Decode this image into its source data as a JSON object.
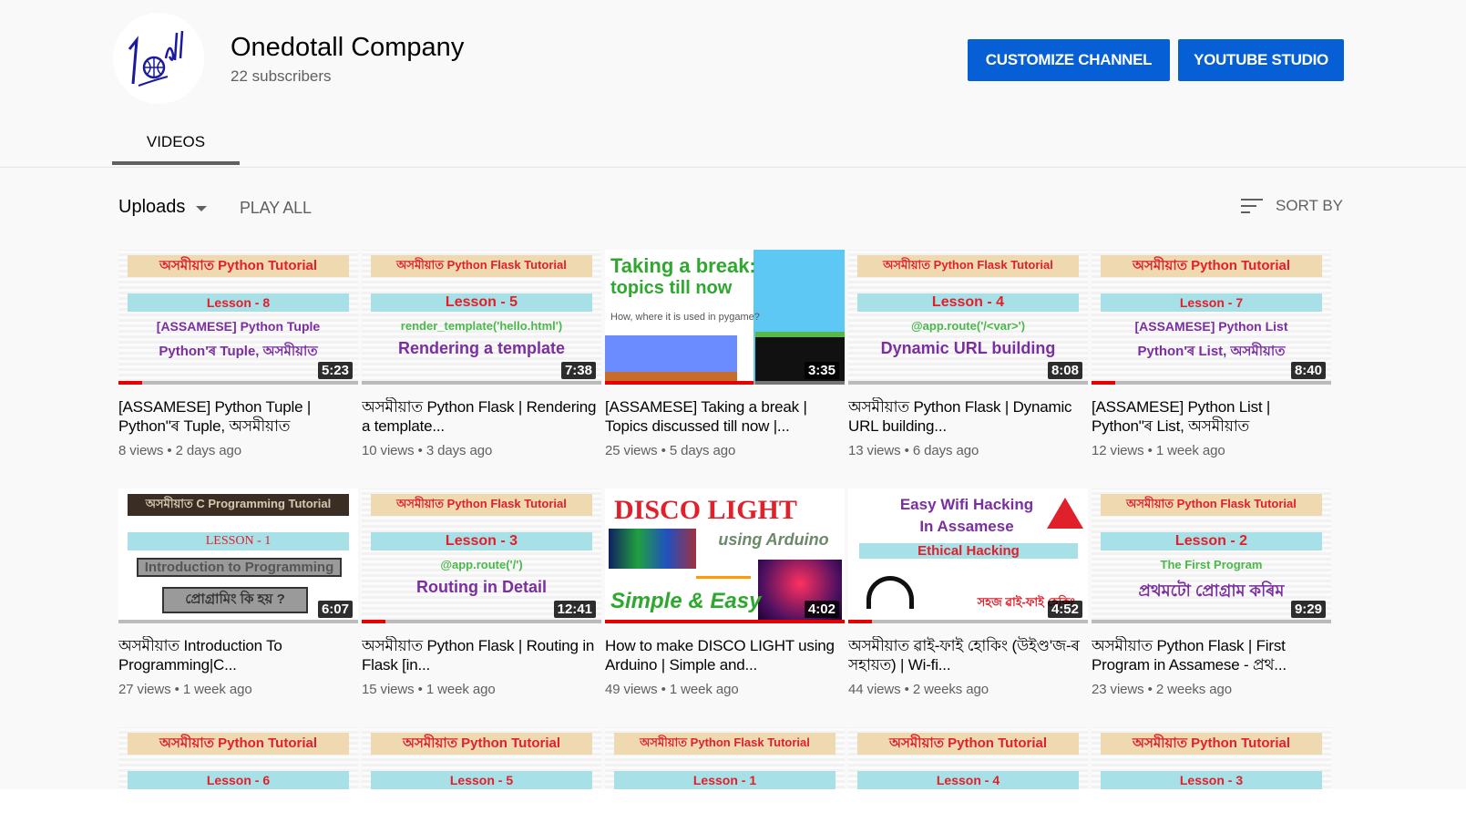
{
  "channel": {
    "name": "Onedotall Company",
    "subscribers": "22 subscribers",
    "logo_text": "1all"
  },
  "header": {
    "customize_label": "CUSTOMIZE CHANNEL",
    "studio_label": "YOUTUBE STUDIO",
    "tab_videos": "VIDEOS"
  },
  "toolbar": {
    "uploads_label": "Uploads",
    "play_all_label": "PLAY ALL",
    "sort_label": "SORT BY"
  },
  "colors": {
    "accent": "#065fd4",
    "progress": "#e60000",
    "background": "#f9f9f9"
  },
  "videos": [
    {
      "title": "[ASSAMESE] Python Tuple | Python\"ৰ Tuple, অসমীয়াত",
      "views": "8 views",
      "age": "2 days ago",
      "duration": "5:23",
      "progress": 0.1,
      "thumb": {
        "band": "অসমীয়াত Python Tutorial",
        "lesson": "Lesson - 8",
        "line1": "[ASSAMESE] Python Tuple",
        "line2": "Python'ৰ Tuple, অসমীয়াত"
      }
    },
    {
      "title": "অসমীয়াত Python Flask | Rendering a template...",
      "views": "10 views",
      "age": "3 days ago",
      "duration": "7:38",
      "progress": 0.0,
      "thumb": {
        "band": "অসমীয়াত Python Flask Tutorial",
        "lesson": "Lesson - 5",
        "line1": "render_template('hello.html')",
        "line2": "Rendering a template"
      }
    },
    {
      "title": "[ASSAMESE] Taking a break | Topics discussed till now |...",
      "views": "25 views",
      "age": "5 days ago",
      "duration": "3:35",
      "progress": 0.62,
      "thumb": {
        "band": "Taking a break:",
        "lesson": "topics till now",
        "line1": "How, where it is used in pygame?",
        "line2": ""
      }
    },
    {
      "title": "অসমীয়াত Python Flask | Dynamic URL building...",
      "views": "13 views",
      "age": "6 days ago",
      "duration": "8:08",
      "progress": 0.0,
      "thumb": {
        "band": "অসমীয়াত Python Flask Tutorial",
        "lesson": "Lesson - 4",
        "line1": "@app.route('/<var>')",
        "line2": "Dynamic URL building"
      }
    },
    {
      "title": "[ASSAMESE] Python List | Python\"ৰ List, অসমীয়াত",
      "views": "12 views",
      "age": "1 week ago",
      "duration": "8:40",
      "progress": 0.1,
      "thumb": {
        "band": "অসমীয়াত Python Tutorial",
        "lesson": "Lesson - 7",
        "line1": "[ASSAMESE] Python List",
        "line2": "Python'ৰ List, অসমীয়াত"
      }
    },
    {
      "title": "অসমীয়াত Introduction To Programming|C...",
      "views": "27 views",
      "age": "1 week ago",
      "duration": "6:07",
      "progress": 0.0,
      "thumb": {
        "band": "অসমীয়াত C Programming Tutorial",
        "lesson": "LESSON - 1",
        "line1": "Introduction to Programming",
        "line2": "প্ৰোগ্ৰামিং কি হয় ?"
      }
    },
    {
      "title": "অসমীয়াত Python Flask | Routing in Flask [in...",
      "views": "15 views",
      "age": "1 week ago",
      "duration": "12:41",
      "progress": 0.1,
      "thumb": {
        "band": "অসমীয়াত Python Flask Tutorial",
        "lesson": "Lesson - 3",
        "line1": "@app.route('/')",
        "line2": "Routing in Detail"
      }
    },
    {
      "title": "How to make DISCO LIGHT using Arduino | Simple and...",
      "views": "49 views",
      "age": "1 week ago",
      "duration": "4:02",
      "progress": 1.0,
      "thumb": {
        "band": "DISCO LIGHT",
        "lesson": "using Arduino",
        "line1": "Simple & Easy",
        "line2": ""
      }
    },
    {
      "title": "অসমীয়াত ৱাই-ফাই হোকিং (উইণ্ড'জ-ৰ সহায়ত) | Wi-fi...",
      "views": "44 views",
      "age": "2 weeks ago",
      "duration": "4:52",
      "progress": 0.1,
      "thumb": {
        "band": "Easy Wifi Hacking",
        "lesson": "In Assamese",
        "line1": "Ethical Hacking",
        "line2": "সহজ ৱাই-ফাই হেকিং"
      }
    },
    {
      "title": "অসমীয়াত Python Flask | First Program in Assamese - প্ৰথ...",
      "views": "23 views",
      "age": "2 weeks ago",
      "duration": "9:29",
      "progress": 0.0,
      "thumb": {
        "band": "অসমীয়াত Python Flask Tutorial",
        "lesson": "Lesson - 2",
        "line1": "The First Program",
        "line2": "প্ৰথমটো প্ৰোগ্ৰাম কৰিম"
      }
    },
    {
      "title": "",
      "views": "",
      "age": "",
      "duration": "",
      "progress": 0.0,
      "thumb": {
        "band": "অসমীয়াত Python Tutorial",
        "lesson": "Lesson - 6",
        "line1": "",
        "line2": ""
      }
    },
    {
      "title": "",
      "views": "",
      "age": "",
      "duration": "",
      "progress": 0.0,
      "thumb": {
        "band": "অসমীয়াত Python Tutorial",
        "lesson": "Lesson - 5",
        "line1": "",
        "line2": ""
      }
    },
    {
      "title": "",
      "views": "",
      "age": "",
      "duration": "",
      "progress": 0.0,
      "thumb": {
        "band": "অসমীয়াত Python Flask Tutorial",
        "lesson": "Lesson - 1",
        "line1": "",
        "line2": ""
      }
    },
    {
      "title": "",
      "views": "",
      "age": "",
      "duration": "",
      "progress": 0.0,
      "thumb": {
        "band": "অসমীয়াত Python Tutorial",
        "lesson": "Lesson - 4",
        "line1": "",
        "line2": ""
      }
    },
    {
      "title": "",
      "views": "",
      "age": "",
      "duration": "",
      "progress": 0.0,
      "thumb": {
        "band": "অসমীয়াত Python Tutorial",
        "lesson": "Lesson - 3",
        "line1": "",
        "line2": ""
      }
    }
  ]
}
